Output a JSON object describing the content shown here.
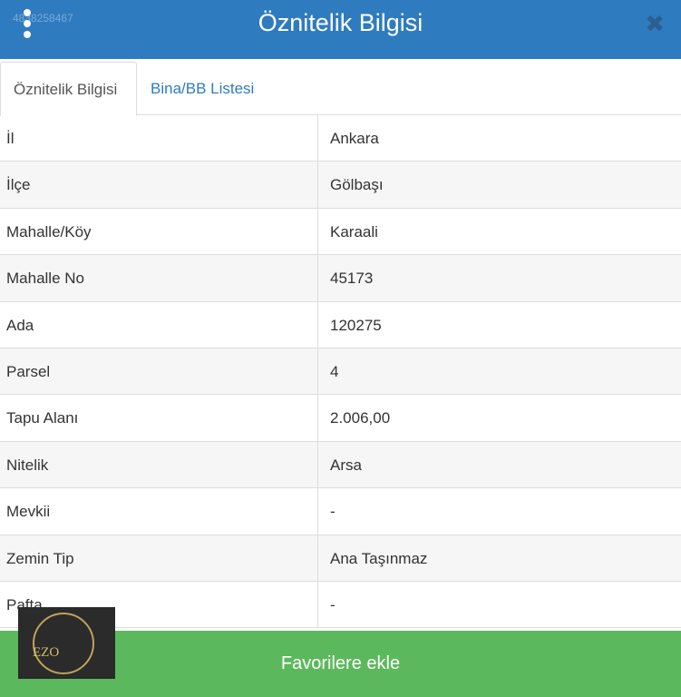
{
  "header": {
    "title": "Öznitelik Bilgisi",
    "watermark": "4838258467",
    "close_symbol": "✖",
    "bg_color": "#2f7bbf"
  },
  "tabs": [
    {
      "label": "Öznitelik Bilgisi",
      "active": true
    },
    {
      "label": "Bina/BB Listesi",
      "active": false
    }
  ],
  "rows": [
    {
      "key": "İl",
      "value": "Ankara"
    },
    {
      "key": "İlçe",
      "value": "Gölbaşı"
    },
    {
      "key": "Mahalle/Köy",
      "value": "Karaali"
    },
    {
      "key": "Mahalle No",
      "value": "45173"
    },
    {
      "key": "Ada",
      "value": "120275"
    },
    {
      "key": "Parsel",
      "value": "4"
    },
    {
      "key": "Tapu Alanı",
      "value": "2.006,00"
    },
    {
      "key": "Nitelik",
      "value": "Arsa"
    },
    {
      "key": "Mevkii",
      "value": "-"
    },
    {
      "key": "Zemin Tip",
      "value": "Ana Taşınmaz"
    },
    {
      "key": "Pafta",
      "value": "-"
    }
  ],
  "logo": {
    "text": "EZO"
  },
  "footer": {
    "button_label": "Favorilere ekle",
    "button_color": "#5cb85c"
  }
}
